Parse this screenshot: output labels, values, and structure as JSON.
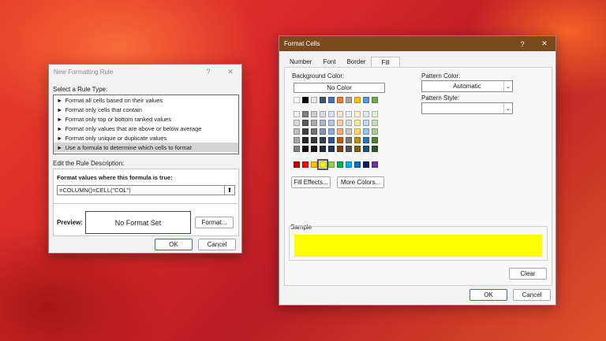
{
  "new_formatting_rule": {
    "title": "New Formatting Rule",
    "help": "?",
    "close": "✕",
    "select_rule_type_label": "Select a Rule Type:",
    "rule_types": [
      {
        "label": "Format all cells based on their values"
      },
      {
        "label": "Format only cells that contain"
      },
      {
        "label": "Format only top or bottom ranked values"
      },
      {
        "label": "Format only values that are above or below average"
      },
      {
        "label": "Format only unique or duplicate values"
      },
      {
        "label": "Use a formula to determine which cells to format"
      }
    ],
    "arrow": "►",
    "edit_description_label": "Edit the Rule Description:",
    "formula_label": "Format values where this formula is true:",
    "formula_value": "=COLUMN()=CELL(\"COL\")",
    "collapse_icon": "⬆",
    "preview_label": "Preview:",
    "preview_text": "No Format Set",
    "format_button": "Format...",
    "ok": "OK",
    "cancel": "Cancel"
  },
  "format_cells": {
    "title": "Format Cells",
    "help": "?",
    "close": "✕",
    "tabs": [
      {
        "label": "Number"
      },
      {
        "label": "Font"
      },
      {
        "label": "Border"
      },
      {
        "label": "Fill"
      }
    ],
    "background_color_label": "Background Color:",
    "no_color": "No Color",
    "theme_row": [
      "#ffffff",
      "#000000",
      "#e7e6e6",
      "#44546a",
      "#4472c4",
      "#ed7d31",
      "#a5a5a5",
      "#ffc000",
      "#5b9bd5",
      "#70ad47"
    ],
    "shade_rows": [
      [
        "#f2f2f2",
        "#7f7f7f",
        "#d0cece",
        "#d6dce4",
        "#d9e1f2",
        "#fce4d6",
        "#ededed",
        "#fff2cc",
        "#ddebf7",
        "#e2efda"
      ],
      [
        "#d9d9d9",
        "#595959",
        "#aeaaaa",
        "#acb9ca",
        "#b4c6e7",
        "#f8cbad",
        "#dbdbdb",
        "#ffe699",
        "#bdd7ee",
        "#c6e0b4"
      ],
      [
        "#bfbfbf",
        "#404040",
        "#757171",
        "#8497b0",
        "#8ea9db",
        "#f4b084",
        "#c9c9c9",
        "#ffd966",
        "#9bc2e6",
        "#a9d08e"
      ],
      [
        "#a6a6a6",
        "#262626",
        "#3a3838",
        "#333f4f",
        "#2f5597",
        "#c65911",
        "#7b7b7b",
        "#bf8f00",
        "#2f75b5",
        "#548235"
      ],
      [
        "#808080",
        "#0d0d0d",
        "#161616",
        "#222b35",
        "#203764",
        "#833c0c",
        "#525252",
        "#806000",
        "#1f4e78",
        "#375623"
      ]
    ],
    "standard_row": [
      "#c00000",
      "#ff0000",
      "#ffc000",
      "#ffff00",
      "#92d050",
      "#00b050",
      "#00b0f0",
      "#0070c0",
      "#002060",
      "#7030a0"
    ],
    "selected_color": "#ffff00",
    "fill_effects": "Fill Effects...",
    "more_colors": "More Colors...",
    "pattern_color_label": "Pattern Color:",
    "pattern_color_value": "Automatic",
    "pattern_style_label": "Pattern Style:",
    "pattern_style_value": "",
    "sample_label": "Sample",
    "sample_color": "#ffff00",
    "clear": "Clear",
    "ok": "OK",
    "cancel": "Cancel"
  }
}
